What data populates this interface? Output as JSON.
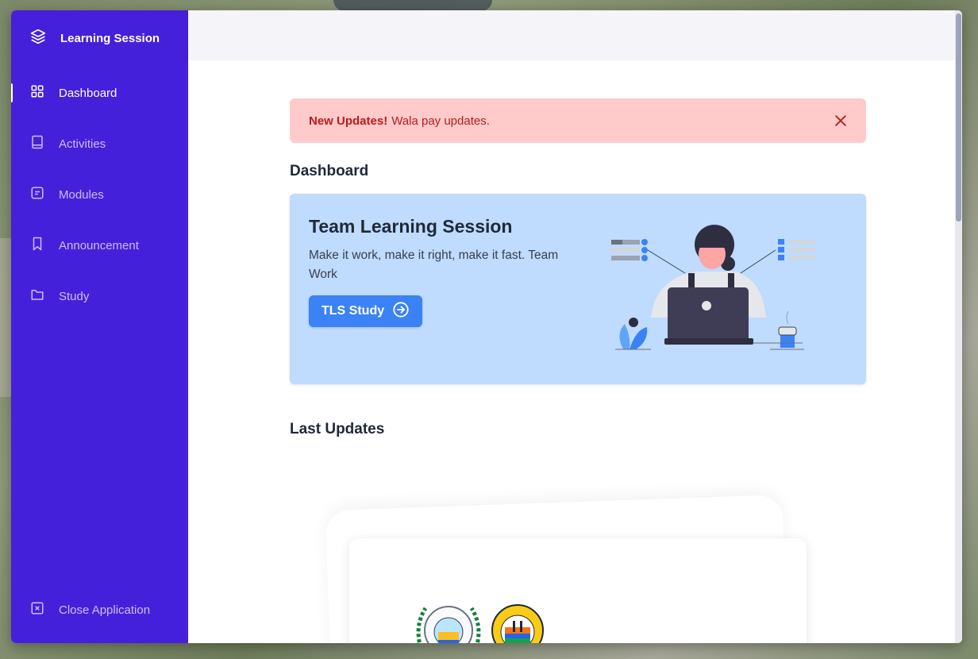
{
  "app": {
    "title": "Learning Session"
  },
  "sidebar": {
    "items": [
      {
        "label": "Dashboard",
        "icon": "grid-icon",
        "active": true
      },
      {
        "label": "Activities",
        "icon": "book-icon",
        "active": false
      },
      {
        "label": "Modules",
        "icon": "document-icon",
        "active": false
      },
      {
        "label": "Announcement",
        "icon": "bookmark-icon",
        "active": false
      },
      {
        "label": "Study",
        "icon": "folder-icon",
        "active": false
      }
    ],
    "close_label": "Close Application"
  },
  "alert": {
    "title": "New Updates!",
    "message": "Wala pay updates."
  },
  "dashboard": {
    "heading": "Dashboard",
    "hero": {
      "title": "Team Learning Session",
      "subtitle": "Make it work, make it right, make it fast. Team Work",
      "button_label": "TLS Study"
    }
  },
  "updates": {
    "heading": "Last Updates"
  },
  "colors": {
    "sidebar": "#4520db",
    "alert_bg": "#fecaca",
    "alert_text": "#b91c1c",
    "hero_bg": "#bfdbfe",
    "button": "#3b82f6"
  }
}
